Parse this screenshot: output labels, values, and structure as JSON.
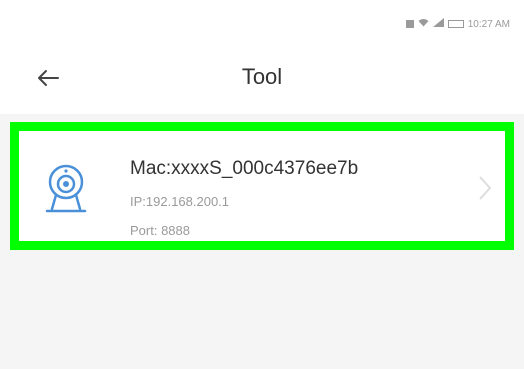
{
  "status_bar": {
    "time": "10:27 AM",
    "battery_text": "",
    "icons": [
      "screenshot-icon",
      "wifi-icon",
      "signal-icon",
      "battery-icon"
    ]
  },
  "app_bar": {
    "title": "Tool",
    "back_icon": "back-arrow-icon"
  },
  "device": {
    "mac": "Mac:xxxxS_000c4376ee7b",
    "ip": "IP:192.168.200.1",
    "port": "Port: 8888",
    "icon": "camera-icon",
    "highlight_color": "#00ff00",
    "icon_color": "#4a90d9"
  },
  "colors": {
    "background": "#f5f5f5",
    "card": "#ffffff",
    "primary_text": "#333333",
    "secondary_text": "#9a9a9a"
  }
}
